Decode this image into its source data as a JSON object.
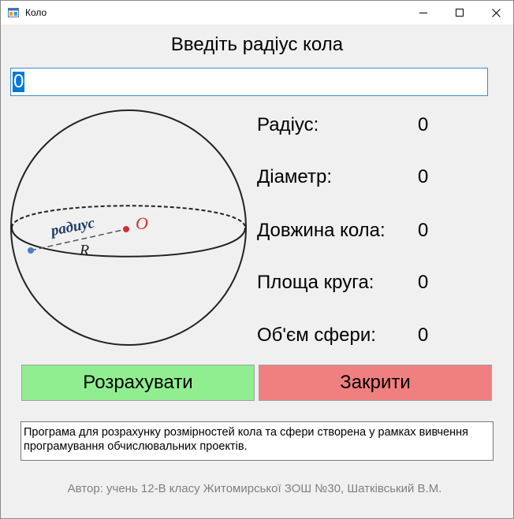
{
  "window": {
    "title": "Коло",
    "icons": {
      "app": "app-icon",
      "minimize": "minimize-icon",
      "maximize": "maximize-icon",
      "close": "close-icon"
    }
  },
  "main": {
    "heading": "Введіть радіус кола",
    "radius_input": {
      "value": "0"
    },
    "illustration": {
      "label_radius": "радиус",
      "label_R": "R",
      "label_O": "O"
    },
    "results": [
      {
        "label": "Радіус:",
        "value": "0"
      },
      {
        "label": "Діаметр:",
        "value": "0"
      },
      {
        "label": "Довжина кола:",
        "value": "0"
      },
      {
        "label": "Площа круга:",
        "value": "0"
      },
      {
        "label": "Об'єм сфери:",
        "value": "0"
      }
    ],
    "buttons": {
      "calculate": {
        "label": "Розрахувати",
        "color": "#90ee90"
      },
      "close": {
        "label": "Закрити",
        "color": "#f08080"
      }
    },
    "description": "Програма для розрахунку розмірностей кола та сфери створена у рамках вивчення програмування обчислювальних проектів.",
    "author": "Автор: учень 12-В класу Житомирської ЗОШ №30, Шатківський В.М."
  },
  "colors": {
    "accent": "#0078d7",
    "background": "#f0f0f0"
  }
}
